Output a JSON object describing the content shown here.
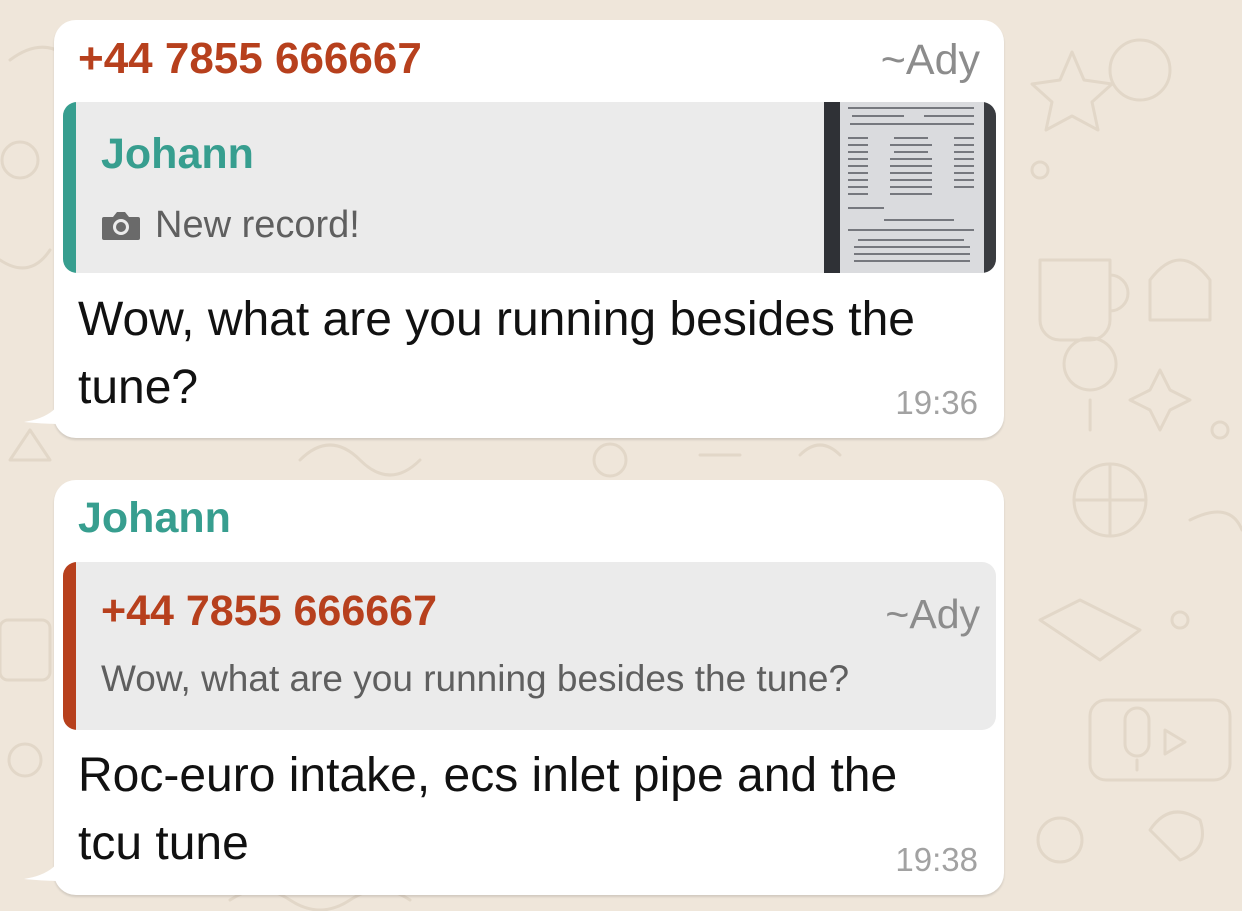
{
  "messages": [
    {
      "sender": {
        "phone": "+44 7855 666667",
        "alias": "~Ady"
      },
      "quote": {
        "author": "Johann",
        "media_icon": "camera-icon",
        "media_label": "New record!",
        "thumbnail": "receipt-photo"
      },
      "text": "Wow, what are you running besides the tune?",
      "time": "19:36"
    },
    {
      "sender": {
        "name": "Johann"
      },
      "quote": {
        "phone": "+44 7855 666667",
        "alias": "~Ady",
        "text": "Wow, what are you running besides the tune?"
      },
      "text": "Roc-euro intake, ecs inlet pipe and the tcu tune",
      "time": "19:38"
    }
  ],
  "colors": {
    "background": "#efe6da",
    "bubble": "#ffffff",
    "quote_bg": "#ebebeb",
    "sender_red": "#b7401d",
    "sender_teal": "#379e8f",
    "timestamp": "#a2a2a2"
  }
}
